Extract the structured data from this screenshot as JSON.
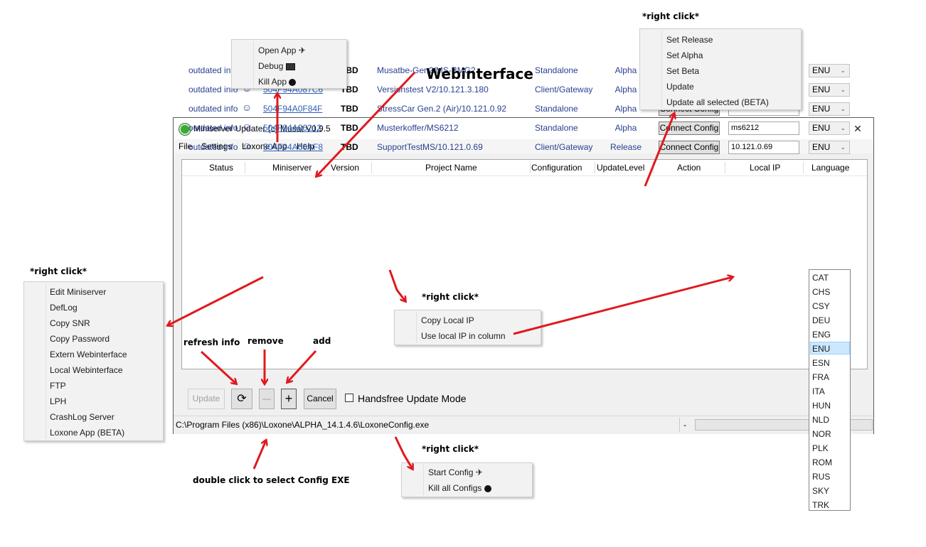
{
  "window": {
    "title": "Miniserver Updater (c) Musat V0.9.5",
    "minimize_glyph": "—",
    "maximize_glyph": "☐",
    "close_glyph": "✕"
  },
  "menu": [
    "File",
    "Settings",
    "Loxone App",
    "Help"
  ],
  "columns": [
    "Status",
    "Miniserver",
    "Version",
    "Project Name",
    "Configuration",
    "UpdateLevel",
    "Action",
    "Local IP",
    "Language"
  ],
  "rows": [
    {
      "status": "outdated info",
      "snr": "504F94A0DEBD",
      "version": "TBD",
      "project": "Musatbe-Gen2/MS-BMG2",
      "config": "Standalone",
      "level": "Alpha",
      "action": "Connect Config",
      "ip": "MS-BMG2",
      "lang": "ENU"
    },
    {
      "status": "outdated info",
      "snr": "504F94A087C6",
      "version": "TBD",
      "project": "Versionstest V2/10.121.3.180",
      "config": "Client/Gateway",
      "level": "Alpha",
      "action": "Connect Config",
      "ip": "",
      "lang": "ENU"
    },
    {
      "status": "outdated info",
      "snr": "504F94A0F84F",
      "version": "TBD",
      "project": "StressCar Gen.2 (Air)/10.121.0.92",
      "config": "Standalone",
      "level": "Alpha",
      "action": "Connect Config",
      "ip": "",
      "lang": "ENU"
    },
    {
      "status": "outdated info",
      "snr": "504F94A06212",
      "version": "TBD",
      "project": "Musterkoffer/MS6212",
      "config": "Standalone",
      "level": "Alpha",
      "action": "Connect Config",
      "ip": "ms6212",
      "lang": "ENU"
    },
    {
      "status": "outdated info",
      "snr": "504F94A00AF8",
      "version": "TBD",
      "project": "SupportTestMS/10.121.0.69",
      "config": "Client/Gateway",
      "level": "Release",
      "action": "Connect Config",
      "ip": "10.121.0.69",
      "lang": "ENU"
    }
  ],
  "status_icon": "☺",
  "toolbar": {
    "update_label": "Update",
    "refresh_glyph": "⟳",
    "remove_glyph": "—",
    "add_glyph": "+",
    "cancel_label": "Cancel",
    "handsfree_label": "Handsfree Update Mode"
  },
  "statusbar": {
    "path": "C:\\Program Files (x86)\\Loxone\\ALPHA_14.1.4.6\\LoxoneConfig.exe",
    "dash": "-"
  },
  "languages": [
    "CAT",
    "CHS",
    "CSY",
    "DEU",
    "ENG",
    "ENU",
    "ESN",
    "FRA",
    "ITA",
    "HUN",
    "NLD",
    "NOR",
    "PLK",
    "ROM",
    "RUS",
    "SKY",
    "TRK"
  ],
  "selected_language": "ENU",
  "annotations": {
    "webinterface": "Webinterface",
    "right_click": "*right click*",
    "refresh_info": "refresh info",
    "remove": "remove",
    "add": "add",
    "double_click": "double click to select Config EXE"
  },
  "popups": {
    "loxone_app": [
      "Open App",
      "Debug",
      "Kill App"
    ],
    "update_level": [
      "Set Release",
      "Set Alpha",
      "Set Beta",
      "Update",
      "Update all selected (BETA)"
    ],
    "miniserver": [
      "Edit Miniserver",
      "DefLog",
      "Copy SNR",
      "Copy Password",
      "Extern Webinterface",
      "Local Webinterface",
      "FTP",
      "LPH",
      "CrashLog Server",
      "Loxone App (BETA)"
    ],
    "local_ip": [
      "Copy Local IP",
      "Use local IP in column"
    ],
    "config": [
      "Start Config",
      "Kill all Configs"
    ]
  },
  "icons": {
    "open_app": "airplane-icon",
    "debug": "monitor-icon",
    "kill": "bomb-icon",
    "status": "smiley-icon"
  },
  "colors": {
    "arrow": "#e0191f",
    "link": "#2f5fb8",
    "text_blue": "#2a3f8f",
    "selection": "#cce8ff"
  }
}
